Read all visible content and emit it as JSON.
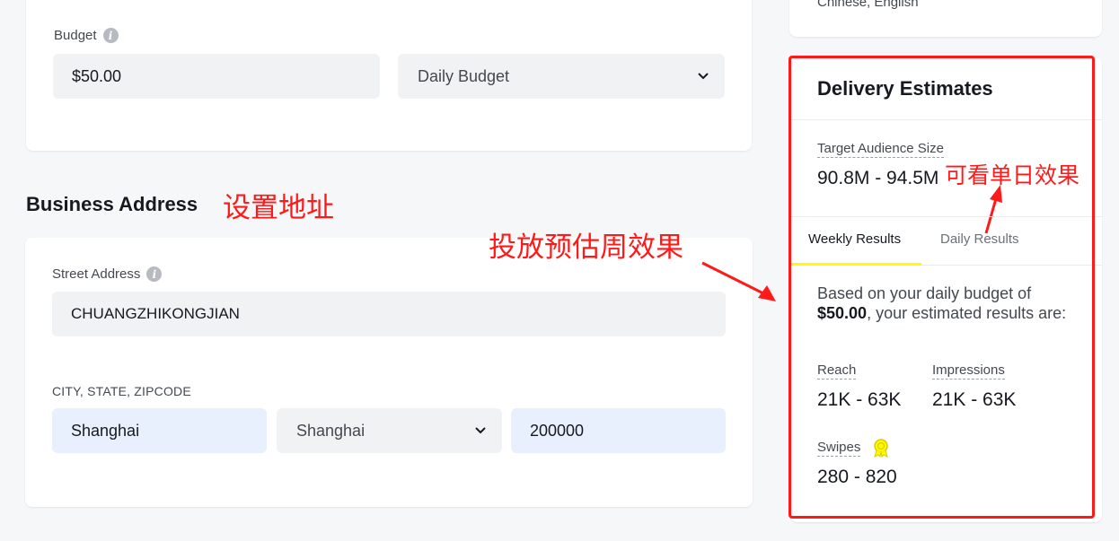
{
  "budget": {
    "label": "Budget",
    "amount": "$50.00",
    "type_selected": "Daily Budget"
  },
  "business_address": {
    "title": "Business Address",
    "street_label": "Street Address",
    "street_value": "CHUANGZHIKONGJIAN",
    "city_label": "CITY, STATE, ZIPCODE",
    "city_value": "Shanghai",
    "state_selected": "Shanghai",
    "zip_value": "200000"
  },
  "top_right_card": {
    "text": "Chinese, English"
  },
  "delivery": {
    "title": "Delivery Estimates",
    "audience_label": "Target Audience Size",
    "audience_value": "90.8M - 94.5M",
    "tabs": [
      {
        "label": "Weekly Results",
        "active": true
      },
      {
        "label": "Daily Results",
        "active": false
      }
    ],
    "summary_prefix": "Based on your daily budget of",
    "summary_amount": "$50.00",
    "summary_suffix": ", your estimated results are:",
    "reach_label": "Reach",
    "reach_value": "21K - 63K",
    "impressions_label": "Impressions",
    "impressions_value": "21K - 63K",
    "swipes_label": "Swipes",
    "swipes_value": "280 - 820"
  },
  "annotations": {
    "address": "设置地址",
    "weekly": "投放预估周效果",
    "daily": "可看单日效果"
  },
  "colors": {
    "annotation": "#ff1a1a",
    "tab_active": "#fffc00",
    "highlight_input": "#e8f0fe"
  }
}
